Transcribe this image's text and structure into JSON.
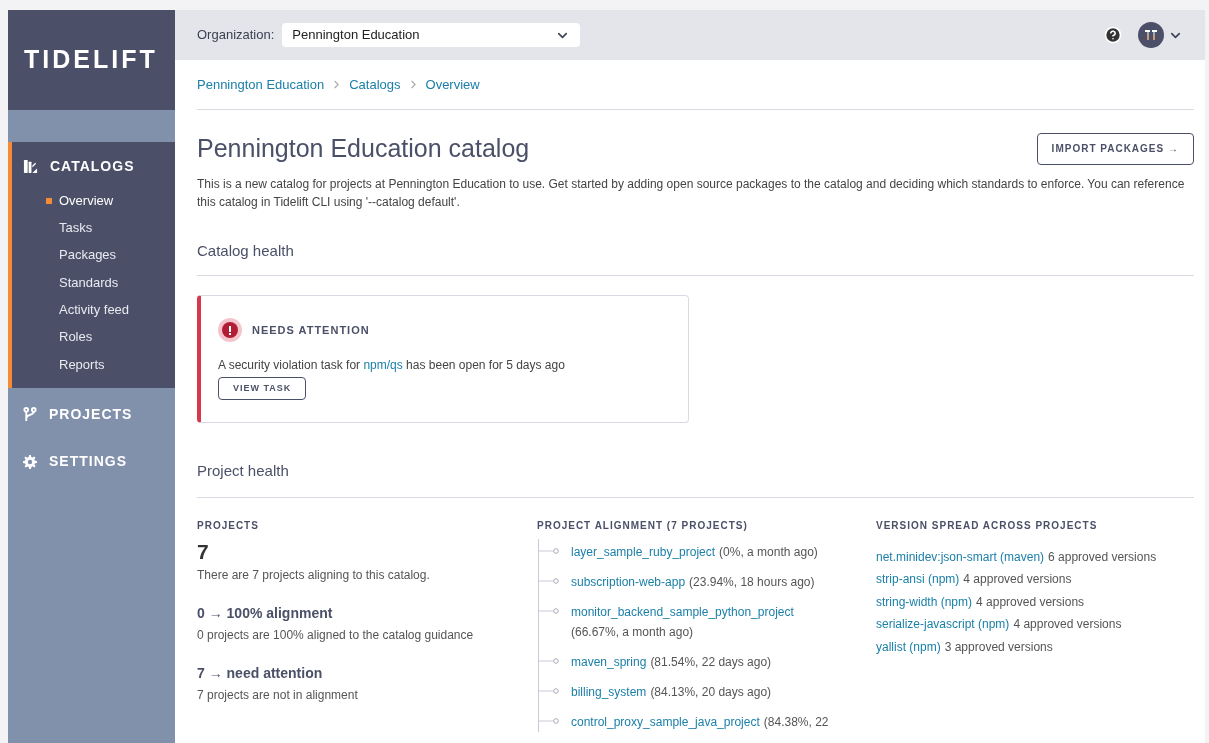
{
  "logo": "TIDELIFT",
  "sidebar": {
    "sections": [
      {
        "label": "CATALOGS",
        "expanded": true,
        "items": [
          {
            "label": "Overview",
            "selected": true
          },
          {
            "label": "Tasks",
            "selected": false
          },
          {
            "label": "Packages",
            "selected": false
          },
          {
            "label": "Standards",
            "selected": false
          },
          {
            "label": "Activity feed",
            "selected": false
          },
          {
            "label": "Roles",
            "selected": false
          },
          {
            "label": "Reports",
            "selected": false
          }
        ]
      },
      {
        "label": "PROJECTS",
        "expanded": false
      },
      {
        "label": "SETTINGS",
        "expanded": false
      }
    ]
  },
  "topbar": {
    "org_label": "Organization:",
    "org_value": "Pennington Education"
  },
  "breadcrumbs": [
    "Pennington Education",
    "Catalogs",
    "Overview"
  ],
  "page": {
    "title": "Pennington Education catalog",
    "import_button": "IMPORT PACKAGES →",
    "description": "This is a new catalog for projects at Pennington Education to use. Get started by adding open source packages to the catalog and deciding which standards to enforce. You can reference this catalog in Tidelift CLI using '--catalog default'."
  },
  "catalog_health": {
    "heading": "Catalog health",
    "alert": {
      "title": "NEEDS ATTENTION",
      "text_before": "A security violation task for ",
      "link": "npm/qs",
      "text_after": " has been open for 5 days ago",
      "button": "VIEW TASK"
    }
  },
  "project_health": {
    "heading": "Project health",
    "projects": {
      "heading": "PROJECTS",
      "count": "7",
      "count_text": "There are 7 projects aligning to this catalog.",
      "stats": [
        {
          "title": "0 → 100% alignment",
          "text": "0 projects are 100% aligned to the catalog guidance"
        },
        {
          "title": "7 → need attention",
          "text": "7 projects are not in alignment"
        }
      ]
    },
    "alignment": {
      "heading": "PROJECT ALIGNMENT (7 PROJECTS)",
      "items": [
        {
          "name": "layer_sample_ruby_project",
          "meta": "(0%, a month ago)"
        },
        {
          "name": "subscription-web-app",
          "meta": "(23.94%, 18 hours ago)"
        },
        {
          "name": "monitor_backend_sample_python_project",
          "meta": "(66.67%, a month ago)"
        },
        {
          "name": "maven_spring",
          "meta": "(81.54%, 22 days ago)"
        },
        {
          "name": "billing_system",
          "meta": "(84.13%, 20 days ago)"
        },
        {
          "name": "control_proxy_sample_java_project",
          "meta": "(84.38%, 22"
        }
      ]
    },
    "versions": {
      "heading": "VERSION SPREAD ACROSS PROJECTS",
      "items": [
        {
          "package": "net.minidev:json-smart (maven)",
          "count": "6 approved versions"
        },
        {
          "package": "strip-ansi (npm)",
          "count": "4 approved versions"
        },
        {
          "package": "string-width (npm)",
          "count": "4 approved versions"
        },
        {
          "package": "serialize-javascript (npm)",
          "count": "4 approved versions"
        },
        {
          "package": "yallist (npm)",
          "count": "3 approved versions"
        }
      ]
    }
  }
}
